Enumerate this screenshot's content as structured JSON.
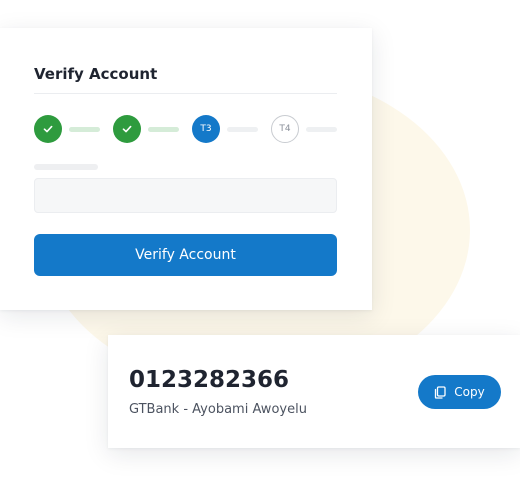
{
  "verify_card": {
    "title": "Verify Account",
    "steps": [
      {
        "status": "done",
        "label": ""
      },
      {
        "status": "done",
        "label": ""
      },
      {
        "status": "active",
        "label": "T3"
      },
      {
        "status": "pending",
        "label": "T4"
      }
    ],
    "button_label": "Verify Account"
  },
  "account_card": {
    "account_number": "0123282366",
    "account_name": "GTBank - Ayobami Awoyelu",
    "copy_label": "Copy",
    "copy_icon": "copy-icon"
  },
  "colors": {
    "primary": "#1479c9",
    "success": "#2e9b3e",
    "success_light": "#d5ecd8",
    "blob": "#fdf8ea"
  }
}
